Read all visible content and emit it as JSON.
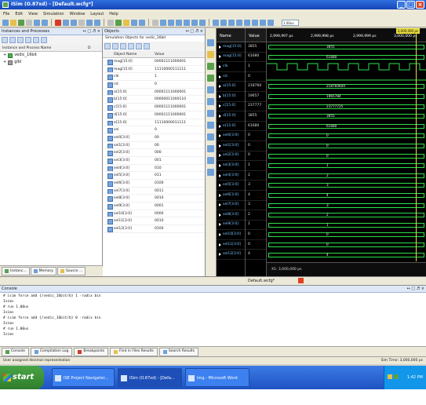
{
  "window": {
    "title": "ISim (O.87xd) - [Default.wcfg*]",
    "min": "_",
    "max": "□",
    "close": "×"
  },
  "menu": [
    "File",
    "Edit",
    "View",
    "Simulation",
    "Window",
    "Layout",
    "Help"
  ],
  "toolbar": {
    "icons": [
      "#6fa0d8",
      "#e6c04b",
      "#5a9f4c",
      "#c0c0c0",
      "#6fa0d8",
      "#6fa0d8",
      "#d43a2a",
      "#6fa0d8",
      "#6fa0d8",
      "#c0c0c0",
      "#6fa0d8",
      "#6fa0d8",
      "#c0c0c0",
      "#5a9f4c",
      "#e6c04b",
      "#6fa0d8",
      "#6fa0d8",
      "#c0c0c0",
      "#6fa0d8",
      "#6fa0d8",
      "#6fa0d8",
      "#6fa0d8",
      "#6fa0d8",
      "#6fa0d8",
      "#6fa0d8",
      "#6fa0d8",
      "#6fa0d8",
      "#6fa0d8",
      "#6fa0d8",
      "#6fa0d8",
      "#6fa0d8",
      "#6fa0d8"
    ],
    "time_value": "1.00us"
  },
  "instances_panel": {
    "title": "Instances and Processes",
    "controls": "↔ □ ♬ ×",
    "col_name": "Instance and Process Name",
    "col_design": "D",
    "items": [
      {
        "label": "vedic_16bit"
      },
      {
        "label": "glbl"
      }
    ],
    "tabs": [
      "Instanc...",
      "Memory",
      "Source ..."
    ]
  },
  "objects_panel": {
    "title": "Objects",
    "controls": "↔ □ ♬ ×",
    "subtitle": "Simulation Objects for vedic_16bit",
    "col_name": "Object Name",
    "col_value": "Value",
    "rows": [
      {
        "name": "mag[15:0]",
        "value": "00001111000001"
      },
      {
        "name": "mag[15:0]",
        "value": "11110000111111"
      },
      {
        "name": "clk",
        "value": "1"
      },
      {
        "name": "rst",
        "value": "0"
      },
      {
        "name": "a[15:0]",
        "value": "00001111000001"
      },
      {
        "name": "b[15:0]",
        "value": "00000011000110"
      },
      {
        "name": "c[15:0]",
        "value": "00001111000001"
      },
      {
        "name": "d[15:0]",
        "value": "00001111000001"
      },
      {
        "name": "e[15:0]",
        "value": "11110000011111"
      },
      {
        "name": "sel",
        "value": "0"
      },
      {
        "name": "sel0[3:0]",
        "value": "00"
      },
      {
        "name": "sel1[3:0]",
        "value": "00"
      },
      {
        "name": "sel2[3:0]",
        "value": "000"
      },
      {
        "name": "sel3[3:0]",
        "value": "001"
      },
      {
        "name": "sel4[3:0]",
        "value": "010"
      },
      {
        "name": "sel5[3:0]",
        "value": "011"
      },
      {
        "name": "sel6[3:0]",
        "value": "0100"
      },
      {
        "name": "sel7[3:0]",
        "value": "0011"
      },
      {
        "name": "sel8[3:0]",
        "value": "0010"
      },
      {
        "name": "sel9[3:0]",
        "value": "0001"
      },
      {
        "name": "sel10[3:0]",
        "value": "0000"
      },
      {
        "name": "sel11[3:0]",
        "value": "0010"
      },
      {
        "name": "sel12[3:0]",
        "value": "0100"
      }
    ]
  },
  "sidebar_icons": [
    "#6fa0d8",
    "#e6c04b",
    "#5a9f4c",
    "#5a9f4c",
    "#6fa0d8",
    "#6fa0d8",
    "#6fa0d8",
    "#6fa0d8",
    "#6fa0d8",
    "#6fa0d8",
    "#6fa0d8",
    "#6fa0d8"
  ],
  "wave": {
    "name_header": "Name",
    "value_header": "Value",
    "time_labels": [
      "2,999,997 ps",
      "2,999,998 ps",
      "2,999,999 ps",
      "3,000,000 ps"
    ],
    "cursor_time": "3,000,000 ps",
    "footer_time": "X1: 3,000,000 ps",
    "rows": [
      {
        "name": "mag[15:0]",
        "value": "3855",
        "kind": "bus",
        "label": "3855"
      },
      {
        "name": "mag[15:0]",
        "value": "61680",
        "kind": "bus",
        "label": "61680"
      },
      {
        "name": "clk",
        "value": "1",
        "kind": "clock",
        "label": ""
      },
      {
        "name": "rst",
        "value": "0",
        "kind": "low",
        "label": ""
      },
      {
        "name": "a[15:0]",
        "value": "218760",
        "kind": "bus",
        "label": "218760600"
      },
      {
        "name": "b[15:0]",
        "value": "19657",
        "kind": "bus",
        "label": "1965784"
      },
      {
        "name": "c[15:0]",
        "value": "237777",
        "kind": "bus",
        "label": "23777725"
      },
      {
        "name": "d[15:0]",
        "value": "3855",
        "kind": "bus",
        "label": "3855"
      },
      {
        "name": "e[15:0]",
        "value": "61680",
        "kind": "bus",
        "label": "61680"
      },
      {
        "name": "sel0[3:0]",
        "value": "0",
        "kind": "bus",
        "label": "0"
      },
      {
        "name": "sel1[3:0]",
        "value": "0",
        "kind": "bus",
        "label": "0"
      },
      {
        "name": "sel2[3:0]",
        "value": "0",
        "kind": "bus",
        "label": "0"
      },
      {
        "name": "sel3[3:0]",
        "value": "1",
        "kind": "bus",
        "label": "1"
      },
      {
        "name": "sel4[3:0]",
        "value": "2",
        "kind": "bus",
        "label": "2"
      },
      {
        "name": "sel5[3:0]",
        "value": "3",
        "kind": "bus",
        "label": "3"
      },
      {
        "name": "sel6[3:0]",
        "value": "4",
        "kind": "bus",
        "label": "4"
      },
      {
        "name": "sel7[3:0]",
        "value": "3",
        "kind": "bus",
        "label": "3"
      },
      {
        "name": "sel8[3:0]",
        "value": "2",
        "kind": "bus",
        "label": "2"
      },
      {
        "name": "sel9[3:0]",
        "value": "1",
        "kind": "bus",
        "label": "1"
      },
      {
        "name": "sel10[3:0]",
        "value": "0",
        "kind": "bus",
        "label": "0"
      },
      {
        "name": "sel11[3:0]",
        "value": "0",
        "kind": "bus",
        "label": "0"
      },
      {
        "name": "sel12[3:0]",
        "value": "4",
        "kind": "bus",
        "label": "4"
      }
    ],
    "file_tab": "Default.wcfg*"
  },
  "console": {
    "title": "Console",
    "controls": "↔ □ ♬ ×",
    "lines": [
      "# isim force add {/vedic_16bit/b} 1 -radix bin",
      "Isim>",
      "# run 1.00us",
      "Isim>",
      "# isim force add {/vedic_16bit/b} 0 -radix bin",
      "Isim>",
      "# run 1.00us",
      "Isim>"
    ],
    "tabs": [
      "Console",
      "Compilation Log",
      "Breakpoints",
      "Find in Files Results",
      "Search Results"
    ]
  },
  "status": {
    "left": "User assigned decimal representation",
    "right": "Sim Time: 3,000,000 ps"
  },
  "taskbar": {
    "start": "start",
    "items": [
      "ISE Project Navigator...",
      "ISim (O.87xd) - [Defa...",
      "Img - Microsoft Word"
    ],
    "clock": "1:42 PM"
  }
}
